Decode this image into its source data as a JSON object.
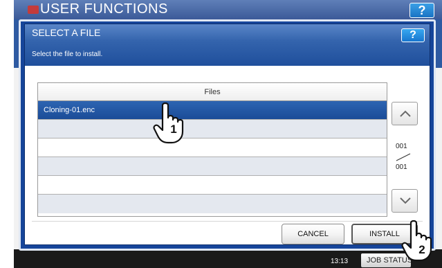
{
  "background": {
    "header_title": "USER FUNCTIONS",
    "help_label": "?",
    "clock": "13:13",
    "job_status_label": "JOB STATUS"
  },
  "dialog": {
    "title": "SELECT A FILE",
    "help_label": "?",
    "subtitle": "Select the file to install."
  },
  "file_list": {
    "column_header": "Files",
    "rows": [
      "Cloning-01.enc",
      "",
      "",
      "",
      "",
      ""
    ],
    "selected_index": 0
  },
  "pager": {
    "current_page": "001",
    "total_pages": "001"
  },
  "buttons": {
    "cancel_label": "CANCEL",
    "install_label": "INSTALL"
  },
  "annotations": {
    "step_1": "1",
    "step_2": "2"
  },
  "colors": {
    "dialog_blue": "#16459a",
    "selected_row": "#1b4c98",
    "help_button": "#1a73c4"
  }
}
